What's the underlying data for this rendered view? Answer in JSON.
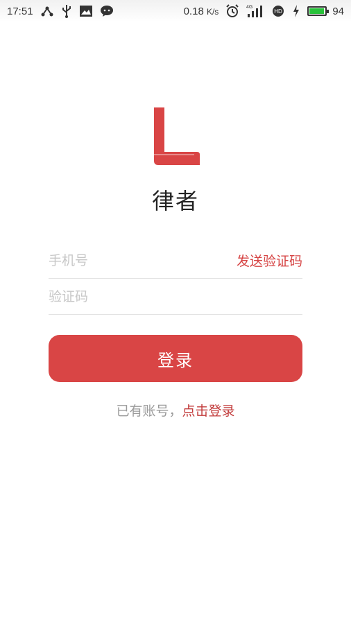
{
  "status_bar": {
    "time": "17:51",
    "net_speed": "0.18",
    "net_unit": "K/s",
    "network_type": "4G",
    "battery_level": "94",
    "battery_percent": 94,
    "left_icons": [
      "share-icon",
      "usb-icon",
      "image-notification-icon",
      "wechat-icon"
    ],
    "right_icons": [
      "alarm-icon",
      "signal-icon",
      "hd-icon",
      "charging-icon",
      "battery-icon"
    ]
  },
  "app": {
    "logo_icon": "l-logo-icon",
    "title": "律者",
    "accent_color": "#d94545"
  },
  "form": {
    "phone_placeholder": "手机号",
    "phone_value": "",
    "send_code_label": "发送验证码",
    "code_placeholder": "验证码",
    "code_value": ""
  },
  "login_button": "登录",
  "footer": {
    "prefix": "已有账号，",
    "link": "点击登录"
  }
}
